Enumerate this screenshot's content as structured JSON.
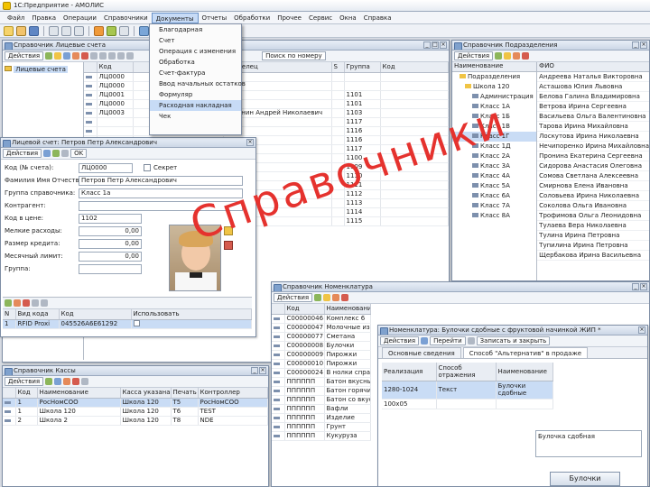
{
  "app": {
    "title": "1С:Предприятие - АМОЛИС"
  },
  "menu": [
    "Файл",
    "Правка",
    "Операции",
    "Справочники",
    "Документы",
    "Отчеты",
    "Обработки",
    "Прочее",
    "Сервис",
    "Окна",
    "Справка"
  ],
  "documents_menu": [
    "Благодарная",
    "Счет",
    "Операция с изменения",
    "Обработка",
    "Счет-фактура",
    "Ввод начальных остатков",
    "Формуляр",
    "Расходная накладная",
    "Чек"
  ],
  "window_left": {
    "title": "Справочник Лицевые счета",
    "action_label": "Действия",
    "search_label": "Поиск по номеру",
    "tree_root": "Лицевые счета",
    "columns": [
      "",
      "Код",
      "",
      "Владелец",
      "S",
      "Группа",
      "Код"
    ],
    "rows": [
      {
        "code": "ЛЦ0000",
        "owner": "",
        "num": ""
      },
      {
        "code": "ЛЦ0000",
        "owner": "",
        "num": ""
      },
      {
        "code": "ЛЦ0001",
        "owner": "",
        "num": "1101"
      },
      {
        "code": "ЛЦ0000",
        "owner": "",
        "num": "1101"
      },
      {
        "code": "ЛЦ0003",
        "owner": "Воронин Андрей Николаевич",
        "num": "1103"
      },
      {
        "code": "",
        "owner": "",
        "num": "1117"
      },
      {
        "code": "",
        "owner": "",
        "num": "1116"
      },
      {
        "code": "",
        "owner": "",
        "num": "1116"
      },
      {
        "code": "",
        "owner": "",
        "num": "1117"
      },
      {
        "code": "",
        "owner": "",
        "num": "1100"
      },
      {
        "code": "",
        "owner": "",
        "num": "1109"
      },
      {
        "code": "",
        "owner": "",
        "num": "1110"
      },
      {
        "code": "",
        "owner": "",
        "num": "1111"
      },
      {
        "code": "",
        "owner": "",
        "num": "1112"
      },
      {
        "code": "",
        "owner": "",
        "num": "1113"
      },
      {
        "code": "",
        "owner": "",
        "num": "1114"
      },
      {
        "code": "",
        "owner": "",
        "num": "1115"
      }
    ]
  },
  "card": {
    "title": "Лицевой счет: Петров Петр Александрович",
    "action_label": "Действия",
    "ok_label": "OK",
    "fields": [
      {
        "label": "Код (№ счета):",
        "value": "ЛЦ0000"
      },
      {
        "label": "Фамилия Имя Отчество:",
        "value": "Петров Петр Александрович"
      },
      {
        "label": "Группа справочника:",
        "value": "Класс 1а"
      },
      {
        "label": "Контрагент:",
        "value": ""
      },
      {
        "label": "Код в цене:",
        "value": "1102"
      },
      {
        "label": "Мелкие расходы:",
        "value": "0,00"
      },
      {
        "label": "Размер кредита:",
        "value": "0,00"
      },
      {
        "label": "Месячный лимит:",
        "value": "0,00"
      },
      {
        "label": "Группа:",
        "value": ""
      }
    ],
    "secret_label": "Секрет",
    "key_columns": [
      "N",
      "Вид кода",
      "Код",
      "Использовать"
    ],
    "key_rows": [
      {
        "n": "1",
        "kind": "RFID Proxi",
        "code": "045526A6E61292"
      }
    ]
  },
  "window_right": {
    "title": "Справочник Подразделения",
    "action_label": "Действия",
    "col_name": "Наименование",
    "col_fio": "ФИО",
    "tree": [
      "Подразделения",
      "Школа 120",
      "Администрация",
      "Класс 1А",
      "Класс 1Б",
      "Класс 1В",
      "Класс 1Г",
      "Класс 1Д",
      "Класс 2А",
      "Класс 3А",
      "Класс 4А",
      "Класс 5А",
      "Класс 6А",
      "Класс 7А",
      "Класс 8А"
    ],
    "people": [
      "Андреева Наталья Викторовна",
      "Асташова Юлия Львовна",
      "Белова Галина Владимировна",
      "Ветрова Ирина Сергеевна",
      "Васильева Ольга Валентиновна",
      "Тарова Ирина Михайловна",
      "Лоскутова Ирина Николаевна",
      "Нечипоренко Ирина Михайловна",
      "Пронина Екатерина Сергеевна",
      "Сидорова Анастасия Олеговна",
      "Сомова Светлана Алексеевна",
      "Смирнова Елена Ивановна",
      "Соловьева Ирина Николаевна",
      "Соколова Ольга Ивановна",
      "Трофимова Ольга Леонидовна",
      "Тулаева Вера Николаевна",
      "Тулина Ирина Петровна",
      "Тупилина Ирина Петровна",
      "Щербакова Ирина Васильевна"
    ]
  },
  "window_kassa": {
    "title": "Справочник Кассы",
    "action_label": "Действия",
    "columns": [
      "Код",
      "Наименование",
      "Касса указана",
      "Печать",
      "Контроллер"
    ],
    "rows": [
      {
        "code": "1",
        "name": "РосНомСОО",
        "kassa": "Школа 120",
        "print": "T5",
        "ctrl": "РосНомСОО",
        "sel": true
      },
      {
        "code": "1",
        "name": "Школа 120",
        "kassa": "Школа 120",
        "print": "T6",
        "ctrl": "TEST",
        "sel": false
      },
      {
        "code": "2",
        "name": "Школа 2",
        "kassa": "Школа 120",
        "print": "T8",
        "ctrl": "NDE",
        "sel": false
      }
    ]
  },
  "window_nomen": {
    "title": "Справочник Номенклатура",
    "action_label": "Действия",
    "columns": [
      "",
      "Код",
      "Наименование"
    ],
    "rows": [
      {
        "code": "С00000046",
        "name": "Комплекс 6"
      },
      {
        "code": "С00000047",
        "name": "Молочные изд."
      },
      {
        "code": "С00000077",
        "name": "Сметана"
      },
      {
        "code": "С00000008",
        "name": "Булочки"
      },
      {
        "code": "С00000009",
        "name": "Пирожки"
      },
      {
        "code": "С00000010",
        "name": "Пирожки"
      },
      {
        "code": "С00000024",
        "name": "В нолки справ."
      },
      {
        "code": "ПППППП",
        "name": "Батон вкусный"
      },
      {
        "code": "ПППППП",
        "name": "Батон горячий"
      },
      {
        "code": "ПППППП",
        "name": "Батон со вкусом"
      },
      {
        "code": "ПППППП",
        "name": "Вафли"
      },
      {
        "code": "ПППППП",
        "name": "Изделие"
      },
      {
        "code": "ПППППП",
        "name": "Грунт"
      },
      {
        "code": "ПППППП",
        "name": "Кукуруза"
      }
    ]
  },
  "window_doc": {
    "title": "Номенклатура: Булочки сдобные с фруктовой начинкой ЖИП *",
    "action_label": "Действия",
    "goto_label": "Перейти",
    "save_label": "Записать и закрыть",
    "tabs": [
      "Основные сведения",
      "Способ \"Альтернатив\" в продаже"
    ],
    "columns": [
      "Реализация",
      "Способ отражения",
      "Наименование"
    ],
    "rows": [
      {
        "a": "1280-1024",
        "b": "Текст",
        "c": "Булочки сдобные",
        "sel": true
      },
      {
        "a": "100х05",
        "b": "",
        "c": "",
        "sel": false
      }
    ],
    "caption": "Булочка сдобная",
    "button": "Булочки"
  },
  "watermark": "Справочники"
}
